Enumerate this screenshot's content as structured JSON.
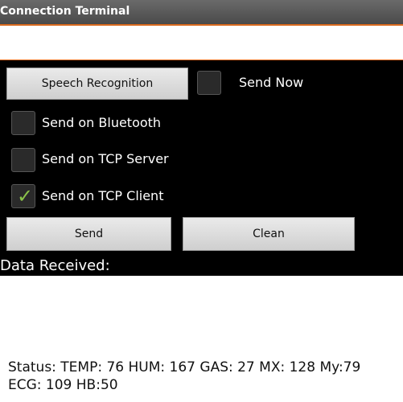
{
  "window": {
    "title": "Connection Terminal"
  },
  "input": {
    "value": ""
  },
  "buttons": {
    "speech_recognition": "Speech Recognition",
    "send": "Send",
    "clean": "Clean"
  },
  "checkboxes": [
    {
      "label": "Send Now",
      "checked": false
    },
    {
      "label": "Send on Bluetooth",
      "checked": false
    },
    {
      "label": "Send on TCP Server",
      "checked": false
    },
    {
      "label": "Send on TCP Client",
      "checked": true
    }
  ],
  "data_received": {
    "label": "Data Received:"
  },
  "status": {
    "text": "Status: TEMP: 76 HUM: 167 GAS: 27 MX: 128 My:79 ECG: 109 HB:50"
  },
  "colors": {
    "accent": "#e8701f",
    "check": "#8bc34a"
  },
  "icons": {
    "check": "check-icon"
  }
}
